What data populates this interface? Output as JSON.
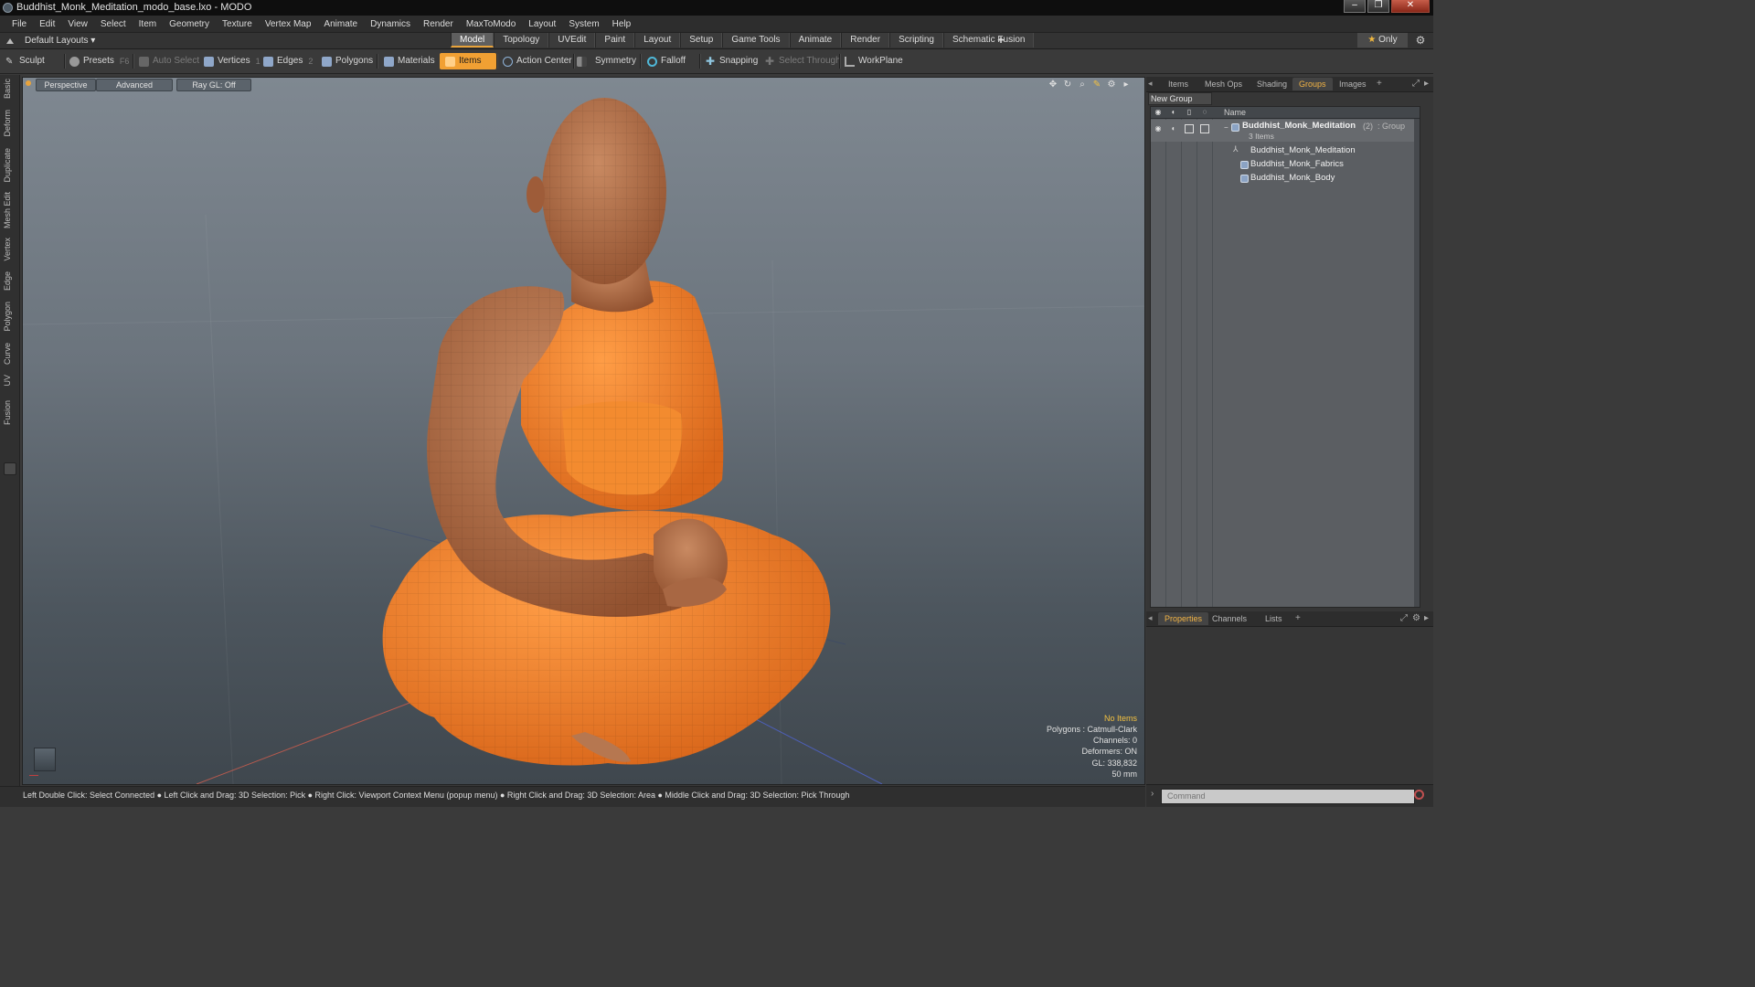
{
  "window": {
    "title": "Buddhist_Monk_Meditation_modo_base.lxo - MODO",
    "controls": [
      "minimize",
      "restore",
      "close"
    ]
  },
  "menu": [
    "File",
    "Edit",
    "View",
    "Select",
    "Item",
    "Geometry",
    "Texture",
    "Vertex Map",
    "Animate",
    "Dynamics",
    "Render",
    "MaxToModo",
    "Layout",
    "System",
    "Help"
  ],
  "layouts": {
    "label": "Default Layouts ▾"
  },
  "mode_tabs": [
    "Model",
    "Topology",
    "UVEdit",
    "Paint",
    "Layout",
    "Setup",
    "Game Tools",
    "Animate",
    "Render",
    "Scripting",
    "Schematic Fusion"
  ],
  "mode_tabs_active": "Model",
  "only_label": "Only",
  "toolbar": {
    "sculpt": "Sculpt",
    "presets": "Presets",
    "presets_key": "F6",
    "auto_select": "Auto Select",
    "vertices": "Vertices",
    "vertices_key": "1",
    "edges": "Edges",
    "edges_key": "2",
    "polygons": "Polygons",
    "materials": "Materials",
    "items": "Items",
    "action_center": "Action Center",
    "symmetry": "Symmetry",
    "falloff": "Falloff",
    "snapping": "Snapping",
    "select_through": "Select Through",
    "workplane": "WorkPlane"
  },
  "left_tabs": [
    "Basic",
    "Deform",
    "Duplicate",
    "Mesh Edit",
    "Vertex",
    "Edge",
    "Polygon",
    "Curve",
    "UV",
    "Fusion"
  ],
  "viewport": {
    "view": "Perspective",
    "shading": "Advanced",
    "raygl": "Ray GL: Off",
    "info": {
      "no_items": "No Items",
      "polygons": "Polygons : Catmull-Clark",
      "channels": "Channels: 0",
      "deformers": "Deformers: ON",
      "gl": "GL: 338,832",
      "focal": "50 mm"
    },
    "colors": {
      "robe": "#f08a2e",
      "skin": "#b46e48",
      "bg_top": "#7f8891",
      "bg_bottom": "#3f474e"
    }
  },
  "statusbar": {
    "hint": "Left Double Click: Select Connected ● Left Click and Drag: 3D Selection: Pick ● Right Click: Viewport Context Menu (popup menu) ● Right Click and Drag: 3D Selection: Area ● Middle Click and Drag: 3D Selection: Pick Through"
  },
  "right_panel": {
    "top_tabs": [
      "Items",
      "Mesh Ops",
      "Shading",
      "Groups",
      "Images"
    ],
    "top_tabs_active": "Groups",
    "new_group": "New Group",
    "list_header": "Name",
    "group": {
      "name": "Buddhist_Monk_Meditation",
      "count": "(2)",
      "type": ": Group",
      "sub": "3 Items",
      "children": [
        "Buddhist_Monk_Meditation",
        "Buddhist_Monk_Fabrics",
        "Buddhist_Monk_Body"
      ]
    },
    "bottom_tabs": [
      "Properties",
      "Channels",
      "Lists"
    ],
    "bottom_tabs_active": "Properties",
    "command_placeholder": "Command"
  }
}
